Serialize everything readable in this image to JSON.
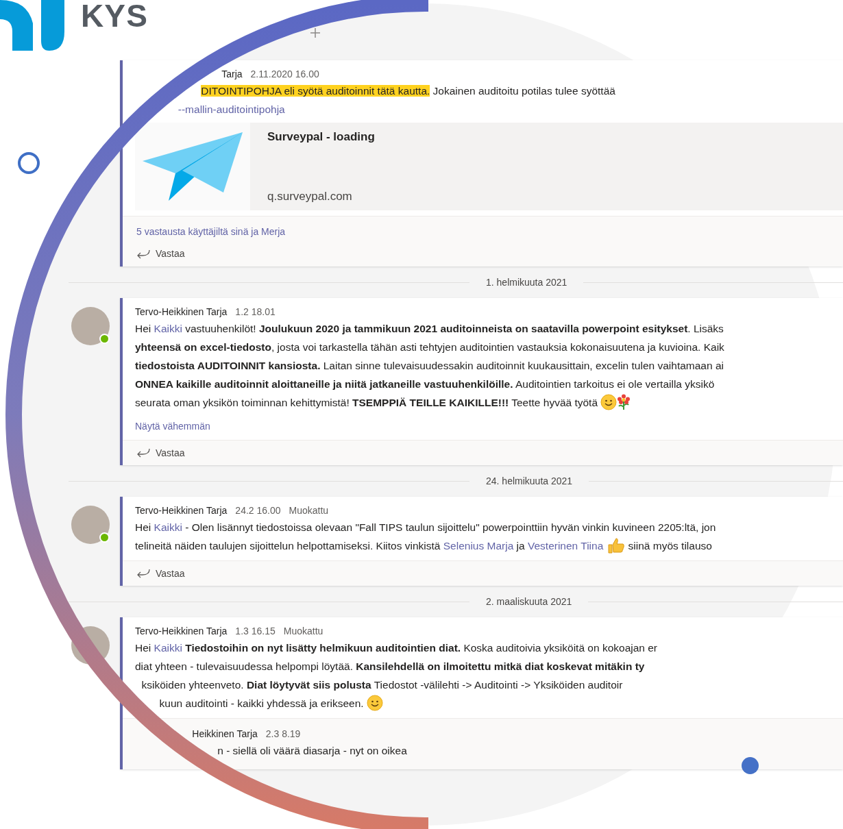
{
  "logo": {
    "text": "KYS"
  },
  "thread": [
    {
      "kind": "message",
      "author": "Tarja",
      "time": "2.11.2020 16.00",
      "lines": [
        [
          {
            "kind": "highlight",
            "text": "DITOINTIPOHJA eli syötä auditoinnit tätä kautta."
          },
          {
            "kind": "plain",
            "text": " Jokainen auditoitu potilas tulee syöttää"
          }
        ],
        [
          {
            "kind": "link",
            "text": "--mallin-auditointipohja"
          }
        ]
      ],
      "preview": {
        "title": "Surveypal - loading",
        "domain": "q.surveypal.com"
      },
      "replies_summary": "5 vastausta käyttäjiltä sinä ja Merja",
      "reply_label": "Vastaa"
    },
    {
      "kind": "date",
      "text": "1. helmikuuta 2021"
    },
    {
      "kind": "message",
      "author": "Tervo-Heikkinen Tarja",
      "time": "1.2 18.01",
      "avatar": true,
      "online": true,
      "lines": [
        [
          {
            "kind": "plain",
            "text": "Hei "
          },
          {
            "kind": "mention",
            "text": "Kaikki"
          },
          {
            "kind": "plain",
            "text": " vastuuhenkilöt! "
          },
          {
            "kind": "bold",
            "text": "Joulukuun 2020 ja tammikuun 2021 auditoinneista on saatavilla powerpoint esitykset"
          },
          {
            "kind": "plain",
            "text": ". Lisäks"
          }
        ],
        [
          {
            "kind": "bold",
            "text": "yhteensä on excel-tiedosto"
          },
          {
            "kind": "plain",
            "text": ", josta voi tarkastella tähän asti tehtyjen auditointien vastauksia kokonaisuutena ja kuvioina. Kaik"
          }
        ],
        [
          {
            "kind": "bold",
            "text": "tiedostoista AUDITOINNIT kansiosta."
          },
          {
            "kind": "plain",
            "text": " Laitan sinne tulevaisuudessakin auditoinnit kuukausittain, excelin tulen vaihtamaan ai"
          }
        ],
        [
          {
            "kind": "bold",
            "text": "ONNEA kaikille auditoinnit aloittaneille ja niitä jatkaneille vastuuhenkilöille."
          },
          {
            "kind": "plain",
            "text": " Auditointien tarkoitus ei ole vertailla yksikö"
          }
        ],
        [
          {
            "kind": "plain",
            "text": "seurata oman yksikön toiminnan kehittymistä! "
          },
          {
            "kind": "bold",
            "text": "TSEMPPIÄ TEILLE KAIKILLE!!!"
          },
          {
            "kind": "plain",
            "text": " Teette hyvää työtä "
          },
          {
            "kind": "smiley"
          },
          {
            "kind": "flower"
          }
        ]
      ],
      "show_less": "Näytä vähemmän",
      "reply_label": "Vastaa"
    },
    {
      "kind": "date",
      "text": "24. helmikuuta 2021"
    },
    {
      "kind": "message",
      "author": "Tervo-Heikkinen Tarja",
      "time": "24.2 16.00",
      "edited": "Muokattu",
      "avatar": true,
      "online": true,
      "lines": [
        [
          {
            "kind": "plain",
            "text": "Hei "
          },
          {
            "kind": "mention",
            "text": "Kaikki"
          },
          {
            "kind": "plain",
            "text": " - Olen lisännyt tiedostoissa olevaan \"Fall TIPS taulun sijoittelu\" powerpointtiin hyvän vinkin kuvineen 2205:ltä, jon"
          }
        ],
        [
          {
            "kind": "plain",
            "text": "telineitä näiden taulujen sijoittelun helpottamiseksi. Kiitos vinkistä "
          },
          {
            "kind": "mention",
            "text": "Selenius Marja"
          },
          {
            "kind": "plain",
            "text": " ja "
          },
          {
            "kind": "mention",
            "text": "Vesterinen Tiina"
          },
          {
            "kind": "thumbs_up"
          },
          {
            "kind": "plain",
            "text": " siinä myös tilauso"
          }
        ]
      ],
      "reply_label": "Vastaa"
    },
    {
      "kind": "date",
      "text": "2. maaliskuuta 2021"
    },
    {
      "kind": "message",
      "author": "Tervo-Heikkinen Tarja",
      "time": "1.3 16.15",
      "edited": "Muokattu",
      "avatar": true,
      "online": false,
      "lines": [
        [
          {
            "kind": "plain",
            "text": "Hei "
          },
          {
            "kind": "mention",
            "text": "Kaikki"
          },
          {
            "kind": "bold",
            "text": " Tiedostoihin on nyt lisätty helmikuun auditointien diat."
          },
          {
            "kind": "plain",
            "text": " Koska auditoivia yksiköitä on kokoajan er"
          }
        ],
        [
          {
            "kind": "plain",
            "text": "diat yhteen - tulevaisuudessa helpompi löytää. "
          },
          {
            "kind": "bold",
            "text": "Kansilehdellä on ilmoitettu mitkä diat koskevat mitäkin ty"
          }
        ],
        [
          {
            "kind": "plain",
            "text": "ksiköiden yhteenveto. "
          },
          {
            "kind": "bold",
            "text": "Diat löytyvät siis polusta"
          },
          {
            "kind": "plain",
            "text": " Tiedostot -välilehti -> Auditointi -> Yksiköiden auditoir"
          }
        ],
        [
          {
            "kind": "plain",
            "text": "kuun auditointi - kaikki yhdessä ja erikseen. "
          },
          {
            "kind": "smiley"
          }
        ]
      ],
      "replies": [
        {
          "author": "Heikkinen Tarja",
          "time": "2.3 8.19",
          "lines": [
            [
              {
                "kind": "plain",
                "text": "n - siellä oli väärä diasarja - nyt on oikea"
              }
            ]
          ]
        }
      ]
    }
  ]
}
